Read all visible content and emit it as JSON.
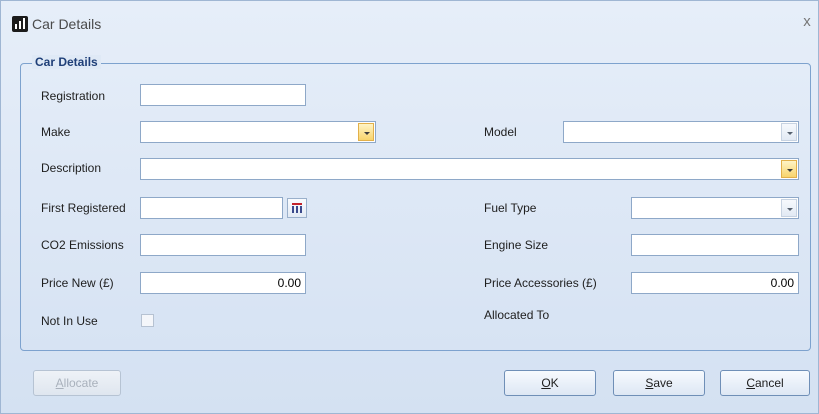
{
  "window": {
    "title": "Car Details",
    "close_glyph": "x"
  },
  "group": {
    "title": "Car Details"
  },
  "fields": {
    "registration": {
      "label": "Registration",
      "value": ""
    },
    "make": {
      "label": "Make",
      "value": ""
    },
    "model": {
      "label": "Model",
      "value": ""
    },
    "description": {
      "label": "Description",
      "value": ""
    },
    "first_registered": {
      "label": "First Registered",
      "value": ""
    },
    "fuel_type": {
      "label": "Fuel Type",
      "value": ""
    },
    "co2_emissions": {
      "label": "CO2 Emissions",
      "value": ""
    },
    "engine_size": {
      "label": "Engine Size",
      "value": ""
    },
    "price_new": {
      "label": "Price New (£)",
      "value": "0.00"
    },
    "price_accessories": {
      "label": "Price Accessories (£)",
      "value": "0.00"
    },
    "not_in_use": {
      "label": "Not In Use",
      "checked": false
    },
    "allocated_to": {
      "label": "Allocated To",
      "value": ""
    }
  },
  "buttons": {
    "allocate": {
      "mnemonic": "A",
      "rest": "llocate",
      "enabled": false
    },
    "ok": {
      "mnemonic": "O",
      "rest": "K"
    },
    "save": {
      "mnemonic": "S",
      "rest": "ave"
    },
    "cancel": {
      "mnemonic": "C",
      "rest": "ancel"
    }
  },
  "icons": {
    "app": "bar-chart-icon",
    "close": "close-icon",
    "calendar": "calendar-icon",
    "dropdown": "chevron-down-icon"
  },
  "colors": {
    "window_bg": "#dbe6f4",
    "group_border": "#7da2ce",
    "group_title": "#1f3f78",
    "active_dropdown": "#f8d46d"
  }
}
